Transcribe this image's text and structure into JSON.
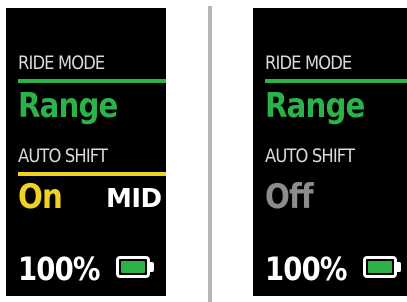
{
  "colors": {
    "background": "#000000",
    "label": "#d9d9d9",
    "mode_accent": "#2bb34a",
    "auto_shift_on": "#f0d320",
    "auto_shift_off": "#8c8c8c",
    "text": "#ffffff",
    "battery_fill": "#2bb34a",
    "divider": "#b5b5b5"
  },
  "screens": [
    {
      "ride_mode_label": "RIDE MODE",
      "ride_mode_value": "Range",
      "auto_shift_label": "AUTO SHIFT",
      "auto_shift_value": "On",
      "assist_level": "MID",
      "battery_percent": "100%",
      "battery_level": 1.0,
      "battery_icon": "battery-full-icon"
    },
    {
      "ride_mode_label": "RIDE MODE",
      "ride_mode_value": "Range",
      "auto_shift_label": "AUTO SHIFT",
      "auto_shift_value": "Off",
      "battery_percent": "100%",
      "battery_level": 1.0,
      "battery_icon": "battery-full-icon"
    }
  ]
}
